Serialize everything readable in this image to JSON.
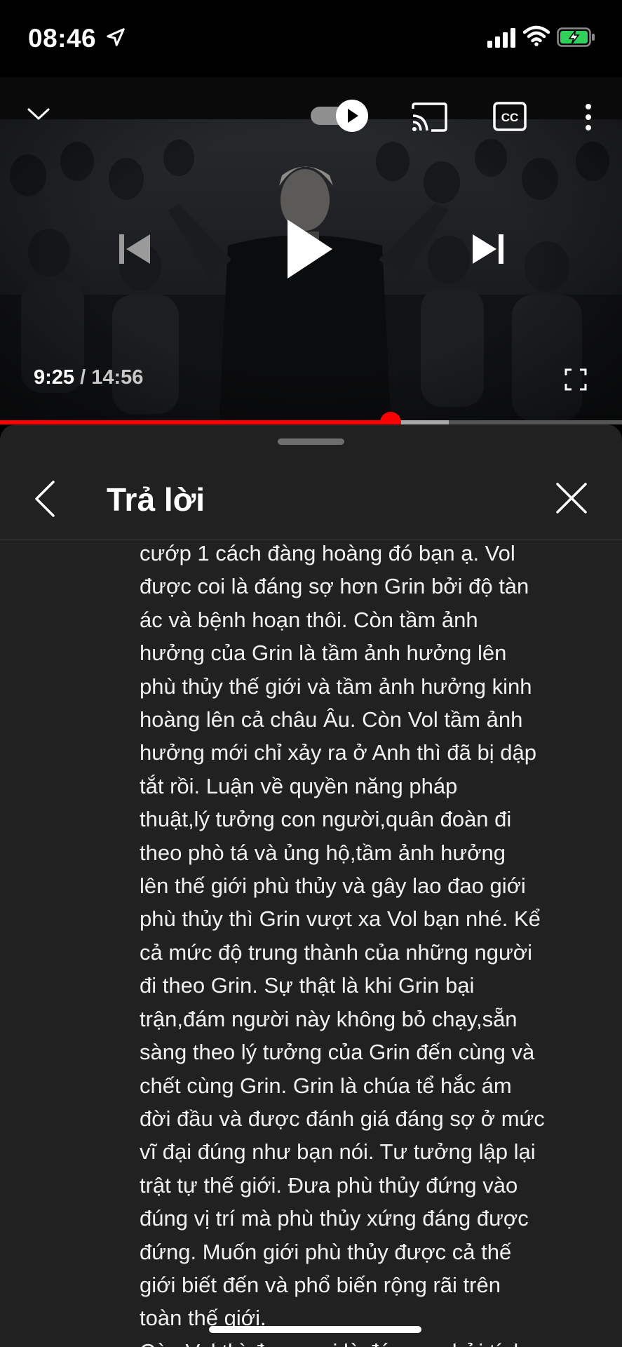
{
  "status_bar": {
    "time": "08:46",
    "icons": [
      "location-arrow-icon",
      "cellular-signal-icon",
      "wifi-icon",
      "battery-charging-icon"
    ]
  },
  "player": {
    "current_time": "9:25",
    "separator": " / ",
    "duration": "14:56",
    "progress_fraction": 0.628,
    "buffered_fraction": 0.722,
    "controls": [
      "chevron-down-icon",
      "autoplay-toggle",
      "cast-icon",
      "captions-icon",
      "more-vertical-icon",
      "previous-icon",
      "play-icon",
      "next-icon",
      "fullscreen-icon"
    ],
    "colors": {
      "accent": "#ff0000"
    }
  },
  "sheet": {
    "title": "Trả lời",
    "lines": [
      "cướp 1 cách đàng hoàng đó bạn ạ. Vol",
      "được coi là đáng sợ hơn Grin bởi độ tàn",
      "ác và bệnh hoạn thôi. Còn tầm ảnh",
      "hưởng của Grin là tầm ảnh hưởng lên",
      "phù thủy thế giới và tầm ảnh hưởng kinh",
      "hoàng lên cả châu Âu. Còn Vol tầm ảnh",
      "hưởng mới chỉ xảy ra ở Anh thì đã bị dập",
      "tắt rồi. Luận về quyền năng pháp",
      "thuật,lý tưởng con người,quân đoàn đi",
      "theo phò tá và ủng hộ,tầm ảnh hưởng",
      "lên thế giới phù thủy và gây lao đao giới",
      "phù thủy thì Grin vượt xa Vol bạn nhé. Kể",
      "cả mức độ trung thành của những người",
      "đi theo Grin. Sự thật là khi Grin bại",
      "trận,đám người này không bỏ chạy,sẵn",
      "sàng theo lý tưởng của Grin đến cùng và",
      "chết cùng Grin. Grin là chúa tể hắc ám",
      "đời đầu và được đánh giá đáng sợ ở mức",
      "vĩ đại đúng như bạn nói. Tư tưởng lập lại",
      "trật tự thế giới. Đưa phù thủy đứng vào",
      "đúng vị trí mà phù thủy xứng đáng được",
      "đứng. Muốn giới phù thủy được cả thế",
      "giới biết đến và phổ biến rộng rãi trên",
      "toàn thế giới.",
      "Còn Vol thì được coi là đáng sợ bởi tính"
    ]
  }
}
